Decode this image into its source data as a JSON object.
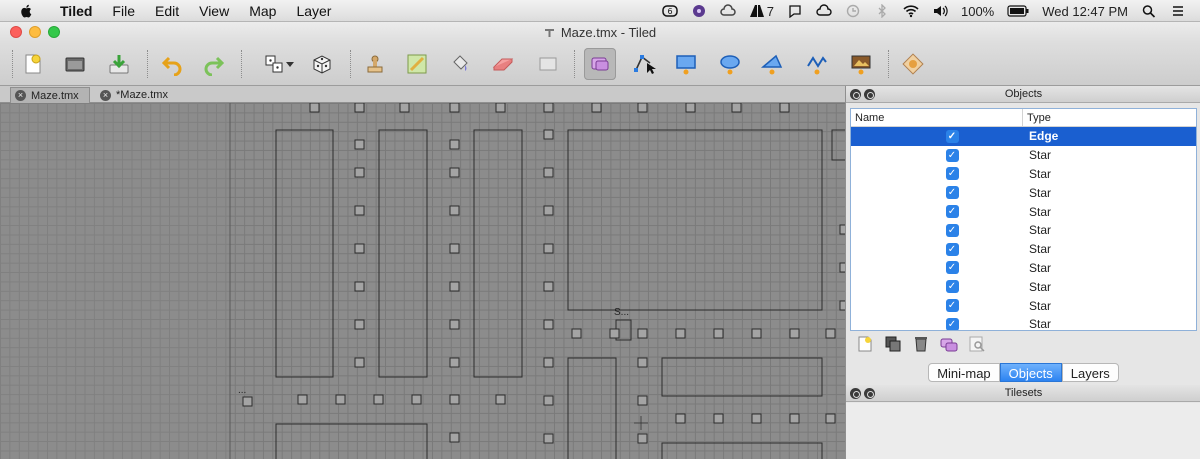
{
  "menubar": {
    "app": "Tiled",
    "menus": [
      "File",
      "Edit",
      "View",
      "Map",
      "Layer"
    ],
    "status": {
      "adobe_badge": "7",
      "battery": "100%",
      "clock": "Wed 12:47 PM"
    }
  },
  "window": {
    "title": "Maze.tmx - Tiled"
  },
  "doc_tabs": [
    {
      "label": "Maze.tmx"
    },
    {
      "label": "*Maze.tmx"
    }
  ],
  "canvas": {
    "label_a": "...",
    "label_b": "S..."
  },
  "objects_panel": {
    "title": "Objects",
    "columns": {
      "name": "Name",
      "type": "Type"
    },
    "rows": [
      {
        "type": "Edge",
        "checked": true,
        "selected": true
      },
      {
        "type": "Star",
        "checked": true
      },
      {
        "type": "Star",
        "checked": true
      },
      {
        "type": "Star",
        "checked": true
      },
      {
        "type": "Star",
        "checked": true
      },
      {
        "type": "Star",
        "checked": true
      },
      {
        "type": "Star",
        "checked": true
      },
      {
        "type": "Star",
        "checked": true
      },
      {
        "type": "Star",
        "checked": true
      },
      {
        "type": "Star",
        "checked": true
      },
      {
        "type": "Star",
        "checked": true
      }
    ],
    "check_glyph": "✓"
  },
  "panel_tabs": [
    "Mini-map",
    "Objects",
    "Layers"
  ],
  "tilesets_panel": {
    "title": "Tilesets"
  },
  "colors": {
    "selection": "#1a5fd0",
    "tab_active": "#2c83f1",
    "checkbox": "#2b82e8"
  }
}
